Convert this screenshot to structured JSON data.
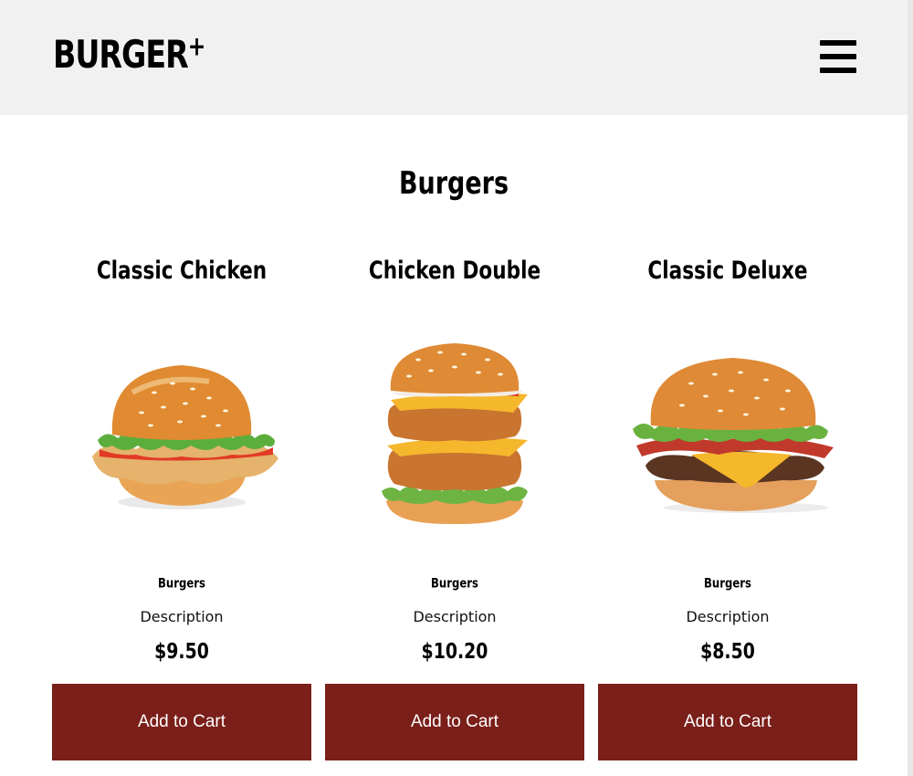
{
  "header": {
    "logo_text": "BURGER",
    "logo_suffix": "+",
    "menu_icon": "hamburger-menu-icon"
  },
  "section": {
    "title": "Burgers"
  },
  "colors": {
    "button_bg": "#7a1f19",
    "header_bg": "#f1f1f1"
  },
  "products": [
    {
      "name": "Classic Chicken",
      "category": "Burgers",
      "description": "Description",
      "price": "$9.50",
      "button_label": "Add to Cart"
    },
    {
      "name": "Chicken Double",
      "category": "Burgers",
      "description": "Description",
      "price": "$10.20",
      "button_label": "Add to Cart"
    },
    {
      "name": "Classic Deluxe",
      "category": "Burgers",
      "description": "Description",
      "price": "$8.50",
      "button_label": "Add to Cart"
    }
  ]
}
